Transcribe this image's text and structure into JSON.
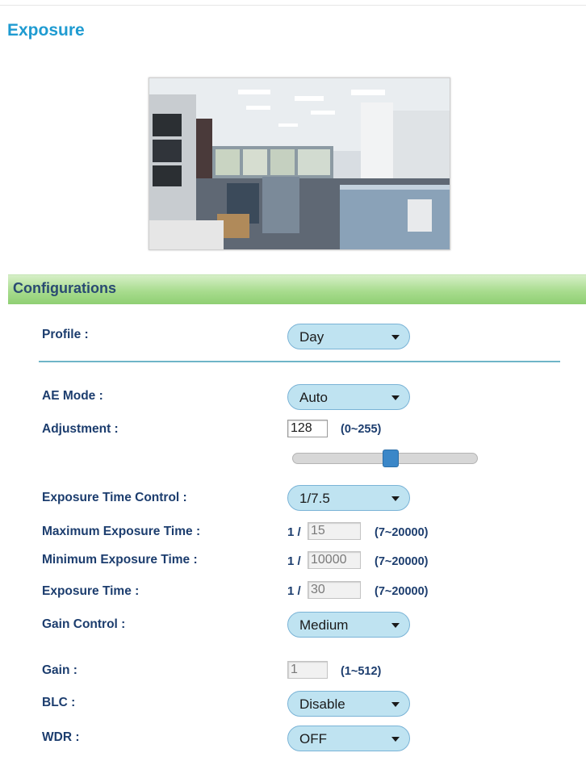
{
  "page": {
    "title": "Exposure"
  },
  "preview": {
    "icon": "camera-preview-image"
  },
  "section": {
    "title": "Configurations"
  },
  "fields": {
    "profile": {
      "label": "Profile :",
      "value": "Day"
    },
    "ae_mode": {
      "label": "AE Mode :",
      "value": "Auto"
    },
    "adjustment": {
      "label": "Adjustment :",
      "value": "128",
      "range": "(0~255)",
      "slider_fraction": 0.5
    },
    "exposure_time_control": {
      "label": "Exposure Time Control :",
      "value": "1/7.5"
    },
    "max_exposure_time": {
      "label": "Maximum Exposure Time :",
      "prefix": "1 /",
      "value": "15",
      "range": "(7~20000)"
    },
    "min_exposure_time": {
      "label": "Minimum Exposure Time :",
      "prefix": "1 /",
      "value": "10000",
      "range": "(7~20000)"
    },
    "exposure_time": {
      "label": "Exposure Time :",
      "prefix": "1 /",
      "value": "30",
      "range": "(7~20000)"
    },
    "gain_control": {
      "label": "Gain Control :",
      "value": "Medium"
    },
    "gain": {
      "label": "Gain :",
      "value": "1",
      "range": "(1~512)"
    },
    "blc": {
      "label": "BLC :",
      "value": "Disable"
    },
    "wdr": {
      "label": "WDR :",
      "value": "OFF"
    }
  },
  "colors": {
    "title": "#1f9bd1",
    "label": "#1c3d6e",
    "select_bg": "#bfe3f1",
    "section_bar": "#a8dc8e",
    "slider_handle": "#3b87c8"
  }
}
